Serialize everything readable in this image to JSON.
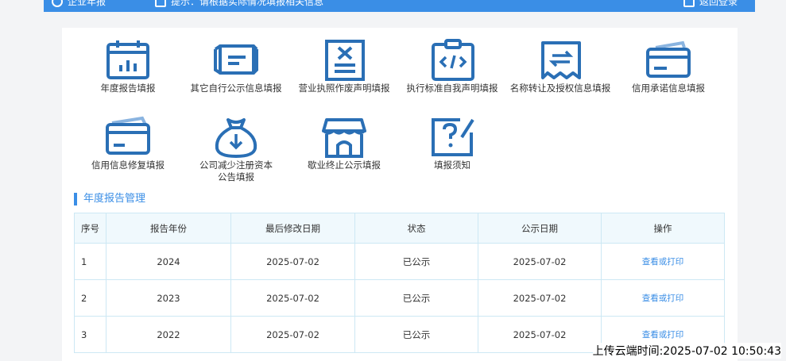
{
  "topbar": {
    "item1": "企业年报",
    "item2": "提示：请根据实际情况填报相关信息",
    "item3": "返回登录"
  },
  "icons": [
    {
      "label": "年度报告填报",
      "icon": "calendar-chart-icon"
    },
    {
      "label": "其它自行公示信息填报",
      "icon": "scroll-icon"
    },
    {
      "label": "营业执照作废声明填报",
      "icon": "document-x-icon"
    },
    {
      "label": "执行标准自我声明填报",
      "icon": "clipboard-code-icon"
    },
    {
      "label": "名称转让及授权信息填报",
      "icon": "receipt-transfer-icon"
    },
    {
      "label": "信用承诺信息填报",
      "icon": "card-icon"
    },
    {
      "label": "信用信息修复填报",
      "icon": "card-stack-icon"
    },
    {
      "label": "公司减少注册资本\n公告填报",
      "icon": "money-bag-icon"
    },
    {
      "label": "歇业终止公示填报",
      "icon": "shop-icon"
    },
    {
      "label": "填报须知",
      "icon": "question-edit-icon"
    }
  ],
  "section": {
    "title": "年度报告管理"
  },
  "table": {
    "headers": [
      "序号",
      "报告年份",
      "最后修改日期",
      "状态",
      "公示日期",
      "操作"
    ],
    "rows": [
      {
        "no": "1",
        "year": "2024",
        "modified": "2025-07-02",
        "status": "已公示",
        "published": "2025-07-02",
        "action": "查看或打印"
      },
      {
        "no": "2",
        "year": "2023",
        "modified": "2025-07-02",
        "status": "已公示",
        "published": "2025-07-02",
        "action": "查看或打印"
      },
      {
        "no": "3",
        "year": "2022",
        "modified": "2025-07-02",
        "status": "已公示",
        "published": "2025-07-02",
        "action": "查看或打印"
      }
    ]
  },
  "stamp": "上传云端时间:2025-07-02 10:50:43",
  "colors": {
    "accent": "#3a8ee6",
    "icon_blue": "#2a6fb5",
    "table_border": "#cde8f4"
  }
}
